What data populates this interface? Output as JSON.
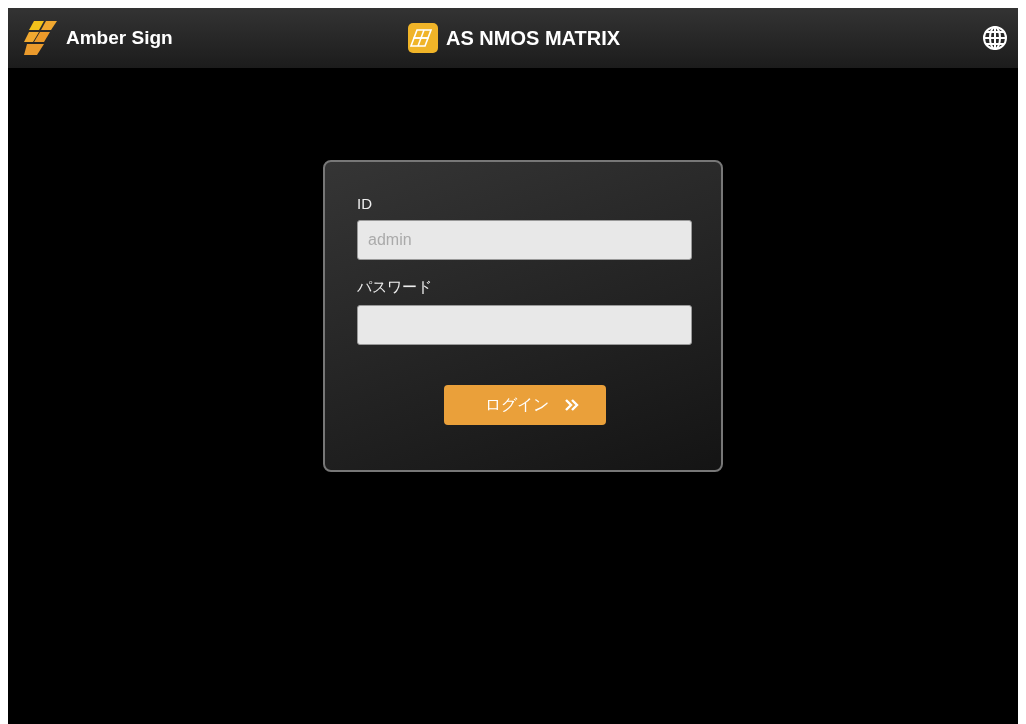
{
  "header": {
    "brand": "Amber Sign",
    "title": "AS NMOS MATRIX"
  },
  "login": {
    "fields": [
      {
        "label": "ID",
        "placeholder": "admin"
      },
      {
        "label": "パスワード"
      }
    ],
    "button": "ログイン"
  }
}
